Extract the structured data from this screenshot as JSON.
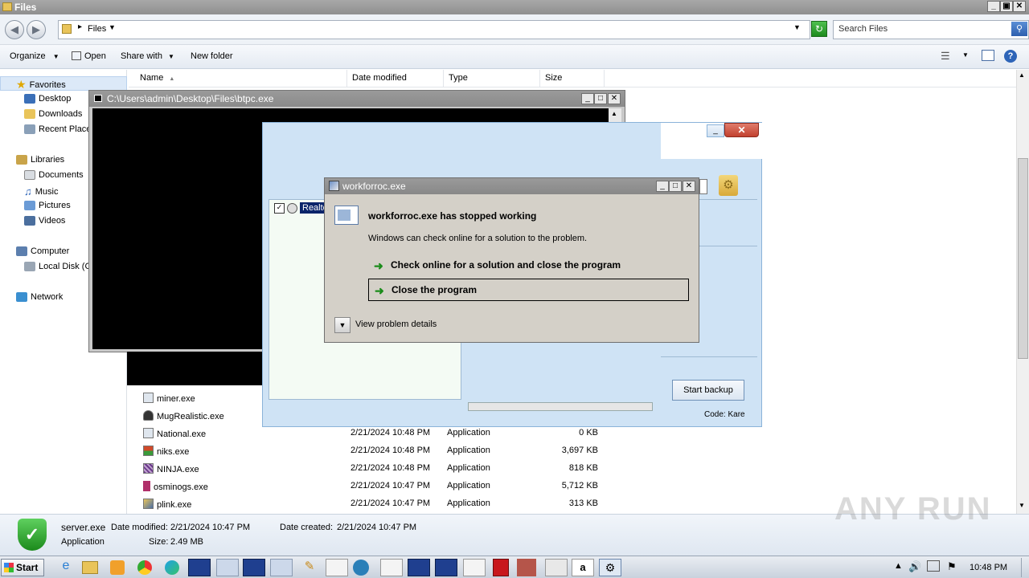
{
  "explorer": {
    "title": "Files",
    "address": "Files",
    "search_placeholder": "Search Files",
    "toolbar": {
      "organize": "Organize",
      "open": "Open",
      "share_with": "Share with",
      "new_folder": "New folder"
    },
    "nav": {
      "favorites": "Favorites",
      "desktop": "Desktop",
      "downloads": "Downloads",
      "recent": "Recent Place",
      "libraries": "Libraries",
      "documents": "Documents",
      "music": "Music",
      "pictures": "Pictures",
      "videos": "Videos",
      "computer": "Computer",
      "local_disk": "Local Disk (C",
      "network": "Network"
    },
    "columns": {
      "name": "Name",
      "date": "Date modified",
      "type": "Type",
      "size": "Size"
    },
    "files": [
      {
        "name": "miner.exe",
        "date": "",
        "type": "",
        "size": ""
      },
      {
        "name": "MugRealistic.exe",
        "date": "",
        "type": "",
        "size": ""
      },
      {
        "name": "National.exe",
        "date": "2/21/2024 10:48 PM",
        "type": "Application",
        "size": "0 KB"
      },
      {
        "name": "niks.exe",
        "date": "2/21/2024 10:48 PM",
        "type": "Application",
        "size": "3,697 KB"
      },
      {
        "name": "NINJA.exe",
        "date": "2/21/2024 10:48 PM",
        "type": "Application",
        "size": "818 KB"
      },
      {
        "name": "osminogs.exe",
        "date": "2/21/2024 10:47 PM",
        "type": "Application",
        "size": "5,712 KB"
      },
      {
        "name": "plink.exe",
        "date": "2/21/2024 10:47 PM",
        "type": "Application",
        "size": "313 KB"
      }
    ],
    "details": {
      "name": "server.exe",
      "modified_label": "Date modified:",
      "modified": "2/21/2024 10:47 PM",
      "created_label": "Date created:",
      "created": "2/21/2024 10:47 PM",
      "type": "Application",
      "size_label": "Size:",
      "size": "2.49 MB"
    }
  },
  "console": {
    "title": "C:\\Users\\admin\\Desktop\\Files\\btpc.exe"
  },
  "backup": {
    "list_item": "Realte",
    "start_button": "Start backup",
    "code": "Code: Kare"
  },
  "dialog": {
    "title": "workforroc.exe",
    "heading": "workforroc.exe has stopped working",
    "message": "Windows can check online for a solution to the problem.",
    "option1": "Check online for a solution and close the program",
    "option2": "Close the program",
    "details": "View problem details"
  },
  "taskbar": {
    "start": "Start",
    "clock": "10:48 PM"
  },
  "watermark": "ANY RUN"
}
